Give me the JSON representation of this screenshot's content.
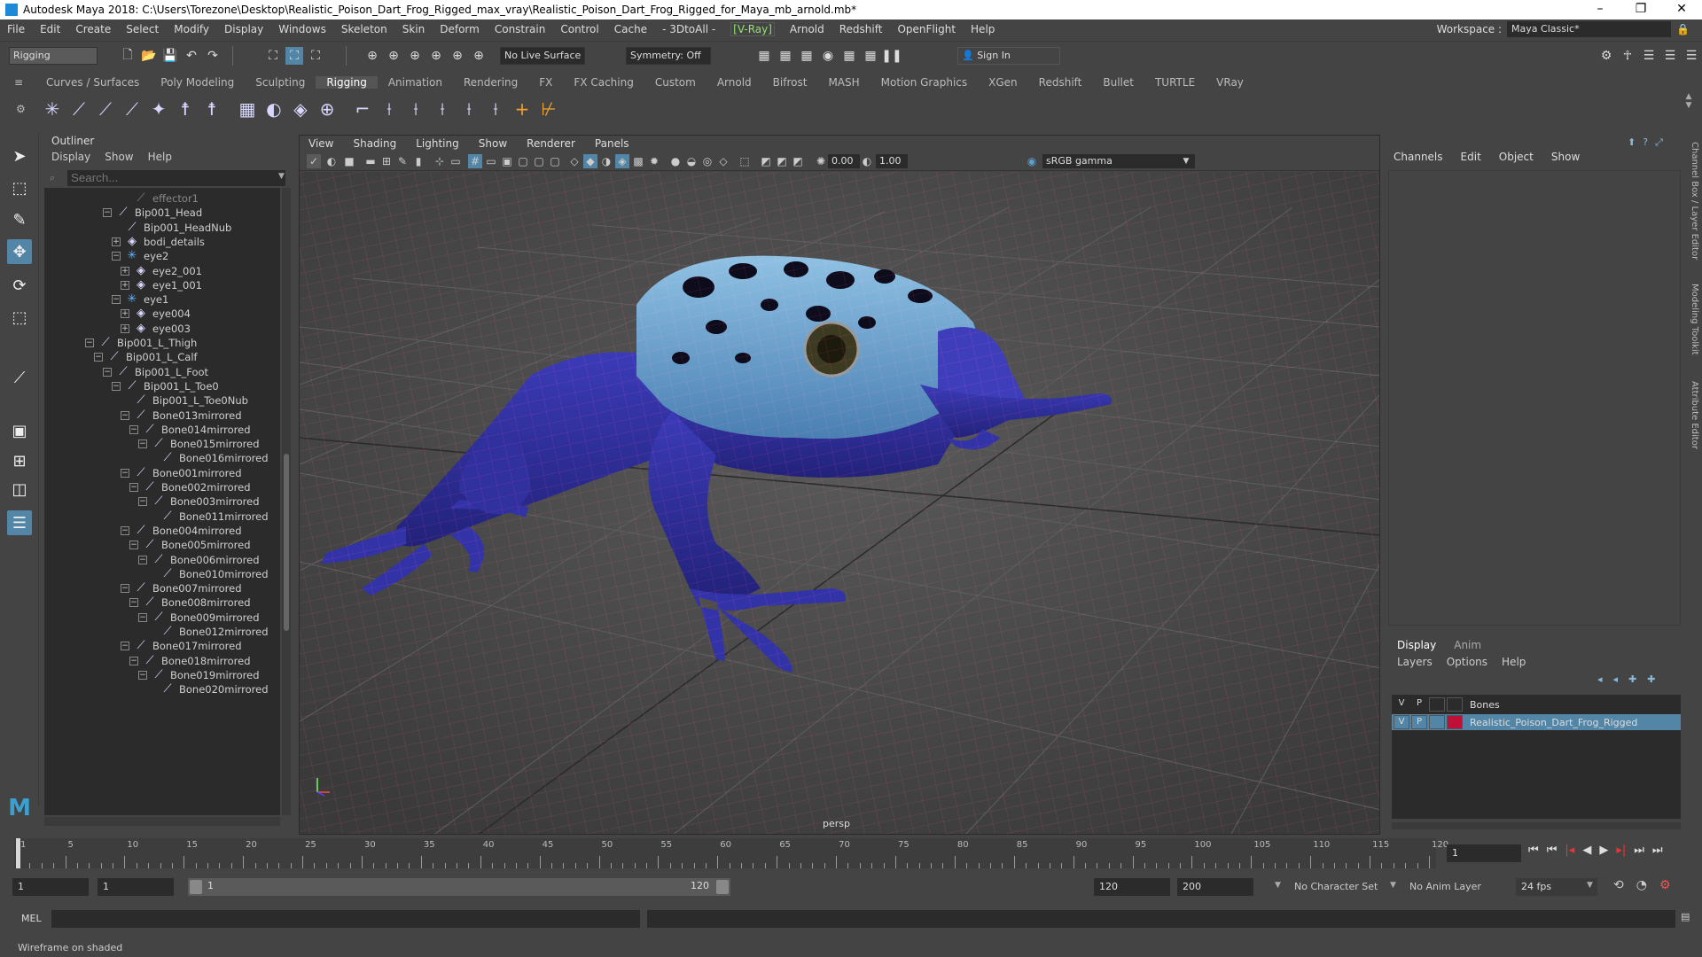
{
  "window": {
    "title": "Autodesk Maya 2018: C:\\Users\\Torezone\\Desktop\\Realistic_Poison_Dart_Frog_Rigged_max_vray\\Realistic_Poison_Dart_Frog_Rigged_for_Maya_mb_arnold.mb*",
    "minimize": "–",
    "restore": "❐",
    "close": "✕"
  },
  "menus": [
    "File",
    "Edit",
    "Create",
    "Select",
    "Modify",
    "Display",
    "Windows",
    "Skeleton",
    "Skin",
    "Deform",
    "Constrain",
    "Control",
    "Cache",
    "- 3DtoAll -",
    "[V-Ray]",
    "Arnold",
    "Redshift",
    "OpenFlight",
    "Help"
  ],
  "workspace": {
    "label": "Workspace :",
    "value": "Maya Classic*"
  },
  "statusline": {
    "mode": "Rigging",
    "live_surface": "No Live Surface",
    "symmetry": "Symmetry: Off",
    "sign_in": "Sign In"
  },
  "shelf_tabs": [
    "Curves / Surfaces",
    "Poly Modeling",
    "Sculpting",
    "Rigging",
    "Animation",
    "Rendering",
    "FX",
    "FX Caching",
    "Custom",
    "Arnold",
    "Bifrost",
    "MASH",
    "Motion Graphics",
    "XGen",
    "Redshift",
    "Bullet",
    "TURTLE",
    "VRay"
  ],
  "active_shelf": "Rigging",
  "outliner": {
    "title": "Outliner",
    "menu": [
      "Display",
      "Show",
      "Help"
    ],
    "search_placeholder": "Search...",
    "items": [
      {
        "label": "effector1",
        "depth": 4,
        "icon": "effector-icon",
        "exp": ""
      },
      {
        "label": "Bip001_Head",
        "depth": 2,
        "icon": "joint-icon",
        "exp": "−"
      },
      {
        "label": "Bip001_HeadNub",
        "depth": 3,
        "icon": "joint-icon",
        "exp": ""
      },
      {
        "label": "bodi_details",
        "depth": 3,
        "icon": "mesh-icon",
        "exp": "+"
      },
      {
        "label": "eye2",
        "depth": 3,
        "icon": "locator-icon",
        "exp": "−"
      },
      {
        "label": "eye2_001",
        "depth": 4,
        "icon": "mesh-icon",
        "exp": "+"
      },
      {
        "label": "eye1_001",
        "depth": 4,
        "icon": "mesh-icon",
        "exp": "+"
      },
      {
        "label": "eye1",
        "depth": 3,
        "icon": "locator-icon",
        "exp": "−"
      },
      {
        "label": "eye004",
        "depth": 4,
        "icon": "mesh-icon",
        "exp": "+"
      },
      {
        "label": "eye003",
        "depth": 4,
        "icon": "mesh-icon",
        "exp": "+"
      },
      {
        "label": "Bip001_L_Thigh",
        "depth": 0,
        "icon": "joint-icon",
        "exp": "−"
      },
      {
        "label": "Bip001_L_Calf",
        "depth": 1,
        "icon": "joint-icon",
        "exp": "−"
      },
      {
        "label": "Bip001_L_Foot",
        "depth": 2,
        "icon": "joint-icon",
        "exp": "−"
      },
      {
        "label": "Bip001_L_Toe0",
        "depth": 3,
        "icon": "joint-icon",
        "exp": "−"
      },
      {
        "label": "Bip001_L_Toe0Nub",
        "depth": 4,
        "icon": "joint-icon",
        "exp": ""
      },
      {
        "label": "Bone013mirrored",
        "depth": 4,
        "icon": "joint-icon",
        "exp": "−"
      },
      {
        "label": "Bone014mirrored",
        "depth": 5,
        "icon": "joint-icon",
        "exp": "−"
      },
      {
        "label": "Bone015mirrored",
        "depth": 6,
        "icon": "joint-icon",
        "exp": "−"
      },
      {
        "label": "Bone016mirrored",
        "depth": 7,
        "icon": "joint-icon",
        "exp": ""
      },
      {
        "label": "Bone001mirrored",
        "depth": 4,
        "icon": "joint-icon",
        "exp": "−"
      },
      {
        "label": "Bone002mirrored",
        "depth": 5,
        "icon": "joint-icon",
        "exp": "−"
      },
      {
        "label": "Bone003mirrored",
        "depth": 6,
        "icon": "joint-icon",
        "exp": "−"
      },
      {
        "label": "Bone011mirrored",
        "depth": 7,
        "icon": "joint-icon",
        "exp": ""
      },
      {
        "label": "Bone004mirrored",
        "depth": 4,
        "icon": "joint-icon",
        "exp": "−"
      },
      {
        "label": "Bone005mirrored",
        "depth": 5,
        "icon": "joint-icon",
        "exp": "−"
      },
      {
        "label": "Bone006mirrored",
        "depth": 6,
        "icon": "joint-icon",
        "exp": "−"
      },
      {
        "label": "Bone010mirrored",
        "depth": 7,
        "icon": "joint-icon",
        "exp": ""
      },
      {
        "label": "Bone007mirrored",
        "depth": 4,
        "icon": "joint-icon",
        "exp": "−"
      },
      {
        "label": "Bone008mirrored",
        "depth": 5,
        "icon": "joint-icon",
        "exp": "−"
      },
      {
        "label": "Bone009mirrored",
        "depth": 6,
        "icon": "joint-icon",
        "exp": "−"
      },
      {
        "label": "Bone012mirrored",
        "depth": 7,
        "icon": "joint-icon",
        "exp": ""
      },
      {
        "label": "Bone017mirrored",
        "depth": 4,
        "icon": "joint-icon",
        "exp": "−"
      },
      {
        "label": "Bone018mirrored",
        "depth": 5,
        "icon": "joint-icon",
        "exp": "−"
      },
      {
        "label": "Bone019mirrored",
        "depth": 6,
        "icon": "joint-icon",
        "exp": "−"
      },
      {
        "label": "Bone020mirrored",
        "depth": 7,
        "icon": "joint-icon",
        "exp": ""
      }
    ]
  },
  "viewport": {
    "menu": [
      "View",
      "Shading",
      "Lighting",
      "Show",
      "Renderer",
      "Panels"
    ],
    "exposure": "0.00",
    "gamma": "1.00",
    "color_space": "sRGB gamma",
    "camera": "persp"
  },
  "channel_box": {
    "menu": [
      "Channels",
      "Edit",
      "Object",
      "Show"
    ]
  },
  "side_tabs": [
    "Channel Box / Layer Editor",
    "Modeling Toolkit",
    "Attribute Editor"
  ],
  "layer_editor": {
    "tabs": [
      "Display",
      "Anim"
    ],
    "menu": [
      "Layers",
      "Options",
      "Help"
    ],
    "header": {
      "v": "V",
      "p": "P",
      "name": "Bones"
    },
    "layers": [
      {
        "v": "V",
        "p": "P",
        "name": "Realistic_Poison_Dart_Frog_Rigged",
        "color": "#c0103a",
        "selected": true
      }
    ]
  },
  "timeline": {
    "ticks": [
      1,
      5,
      10,
      15,
      20,
      25,
      30,
      35,
      40,
      45,
      50,
      55,
      60,
      65,
      70,
      75,
      80,
      85,
      90,
      95,
      100,
      105,
      110,
      115,
      120
    ],
    "current_frame": "1",
    "start": 1,
    "end": 120
  },
  "range": {
    "anim_start": "1",
    "play_start": "1",
    "slider_start": "1",
    "slider_end": "120",
    "play_end": "120",
    "anim_end": "200",
    "character_set": "No Character Set",
    "anim_layer": "No Anim Layer",
    "fps": "24 fps"
  },
  "mel": {
    "label": "MEL"
  },
  "status": {
    "message": "Wireframe on shaded"
  }
}
